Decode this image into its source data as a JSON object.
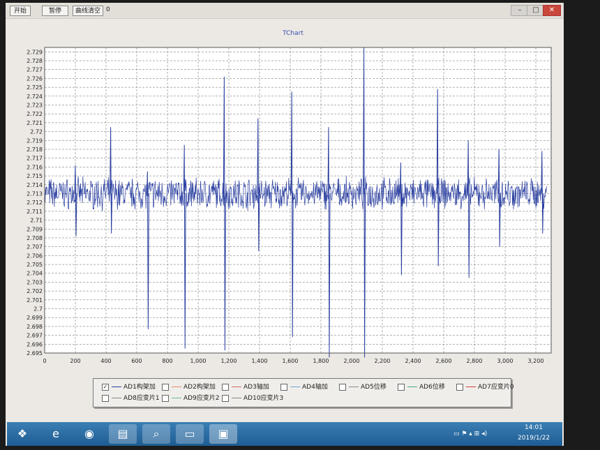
{
  "toolbar": {
    "start": "开始",
    "pause": "暂停",
    "clear": "曲线清空",
    "counter": "0"
  },
  "window_controls": {
    "minimize": "–",
    "maximize": "□",
    "close": "✕"
  },
  "chart_data": {
    "type": "line",
    "title": "TChart",
    "xlabel": "",
    "ylabel": "",
    "xlim": [
      0,
      3300
    ],
    "ylim": [
      2.695,
      2.7295
    ],
    "grid": true,
    "x_ticks": [
      0,
      200,
      400,
      600,
      800,
      1000,
      1200,
      1400,
      1600,
      1800,
      2000,
      2200,
      2400,
      2600,
      2800,
      3000,
      3200
    ],
    "x_tick_labels": [
      "0",
      "200",
      "400",
      "600",
      "800",
      "1,000",
      "1,200",
      "1,400",
      "1,600",
      "1,800",
      "2,000",
      "2,200",
      "2,400",
      "2,600",
      "2,800",
      "3,000",
      "3,200"
    ],
    "y_ticks": [
      2.695,
      2.696,
      2.697,
      2.698,
      2.699,
      2.7,
      2.701,
      2.702,
      2.703,
      2.704,
      2.705,
      2.706,
      2.707,
      2.708,
      2.709,
      2.71,
      2.711,
      2.712,
      2.713,
      2.714,
      2.715,
      2.716,
      2.717,
      2.718,
      2.719,
      2.72,
      2.721,
      2.722,
      2.723,
      2.724,
      2.725,
      2.726,
      2.727,
      2.728,
      2.729
    ],
    "y_tick_labels": [
      "2.695",
      "2.696",
      "2.697",
      "2.698",
      "2.699",
      "2.7",
      "2.701",
      "2.702",
      "2.703",
      "2.704",
      "2.705",
      "2.706",
      "2.707",
      "2.708",
      "2.709",
      "2.71",
      "2.711",
      "2.712",
      "2.713",
      "2.714",
      "2.715",
      "2.716",
      "2.717",
      "2.718",
      "2.719",
      "2.72",
      "2.721",
      "2.722",
      "2.723",
      "2.724",
      "2.725",
      "2.726",
      "2.727",
      "2.728",
      "2.729"
    ],
    "series": [
      {
        "name": "AD1构架加",
        "color": "#2a3fa0",
        "baseline": 2.713,
        "spikes": [
          {
            "x": 200,
            "high": 2.7162,
            "low": 2.7082
          },
          {
            "x": 430,
            "high": 2.7205,
            "low": 2.7085
          },
          {
            "x": 670,
            "high": 2.7155,
            "low": 2.6977
          },
          {
            "x": 910,
            "high": 2.7185,
            "low": 2.6955
          },
          {
            "x": 1170,
            "high": 2.7262,
            "low": 2.6953
          },
          {
            "x": 1390,
            "high": 2.7215,
            "low": 2.7065
          },
          {
            "x": 1610,
            "high": 2.7245,
            "low": 2.6968
          },
          {
            "x": 1850,
            "high": 2.7205,
            "low": 2.6945
          },
          {
            "x": 2080,
            "high": 2.7295,
            "low": 2.6945
          },
          {
            "x": 2320,
            "high": 2.7165,
            "low": 2.7038
          },
          {
            "x": 2560,
            "high": 2.7248,
            "low": 2.7048
          },
          {
            "x": 2760,
            "high": 2.719,
            "low": 2.7035
          },
          {
            "x": 2960,
            "high": 2.718,
            "low": 2.707
          },
          {
            "x": 3240,
            "high": 2.7178,
            "low": 2.7085
          }
        ]
      }
    ],
    "legend_placement": "bottom"
  },
  "legend": {
    "items": [
      {
        "label": "AD1构架加",
        "checked": "☑",
        "color": "#2a3fa0"
      },
      {
        "label": "AD2构架加",
        "checked": "",
        "color": "#e08a6a"
      },
      {
        "label": "AD3轴加",
        "checked": "",
        "color": "#d36a6a"
      },
      {
        "label": "AD4轴加",
        "checked": "",
        "color": "#6aa8d6"
      },
      {
        "label": "AD5位移",
        "checked": "",
        "color": "#888888"
      },
      {
        "label": "AD6位移",
        "checked": "",
        "color": "#4aa88a"
      },
      {
        "label": "AD7应变片0",
        "checked": "",
        "color": "#d63a3a"
      },
      {
        "label": "AD8应变片1",
        "checked": "",
        "color": "#888888"
      },
      {
        "label": "AD9应变片2",
        "checked": "",
        "color": "#6ab89a"
      },
      {
        "label": "AD10应变片3",
        "checked": "",
        "color": "#888888"
      }
    ]
  },
  "taskbar": {
    "start_icon": "windows-logo-icon",
    "apps": [
      "ie-icon",
      "chrome-icon",
      "folder-icon",
      "magnifier-icon",
      "window-icon",
      "app-icon"
    ],
    "time": "14:01",
    "date": "2019/1/22"
  }
}
